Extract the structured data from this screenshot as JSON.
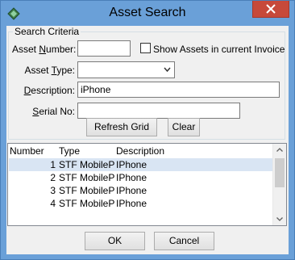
{
  "window": {
    "title": "Asset Search"
  },
  "criteria": {
    "legend": "Search Criteria",
    "asset_number_label_pre": "Asset ",
    "asset_number_label_ul": "N",
    "asset_number_label_post": "umber:",
    "asset_number_value": "",
    "show_assets_label": "Show Assets in current Invoice",
    "show_assets_checked": false,
    "asset_type_label_pre": "Asset ",
    "asset_type_label_ul": "T",
    "asset_type_label_post": "ype:",
    "asset_type_value": "",
    "description_label_pre": "",
    "description_label_ul": "D",
    "description_label_post": "escription:",
    "description_value": "iPhone",
    "serial_label_pre": "",
    "serial_label_ul": "S",
    "serial_label_post": "erial No:",
    "serial_value": "",
    "refresh_label": "Refresh Grid",
    "clear_label": "Clear"
  },
  "grid": {
    "columns": [
      "Number",
      "Type",
      "Description"
    ],
    "rows": [
      {
        "number": "1",
        "type": "STF MobilePho",
        "description": "IPhone"
      },
      {
        "number": "2",
        "type": "STF MobilePho",
        "description": "IPhone"
      },
      {
        "number": "3",
        "type": "STF MobilePho",
        "description": "IPhone"
      },
      {
        "number": "4",
        "type": "STF MobilePho",
        "description": "IPhone"
      }
    ],
    "selected_row": 0
  },
  "footer": {
    "ok_label": "OK",
    "cancel_label": "Cancel"
  }
}
